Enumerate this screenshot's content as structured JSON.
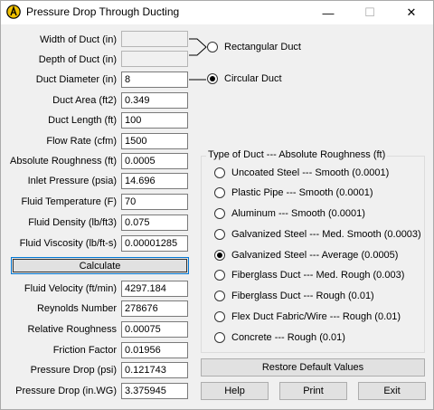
{
  "window": {
    "title": "Pressure Drop Through Ducting",
    "minimize_glyph": "—",
    "maximize_glyph": "☐",
    "close_glyph": "✕"
  },
  "inputs": [
    {
      "label": "Width of Duct (in)",
      "value": "",
      "disabled": true
    },
    {
      "label": "Depth of Duct (in)",
      "value": "",
      "disabled": true
    },
    {
      "label": "Duct Diameter (in)",
      "value": "8"
    },
    {
      "label": "Duct Area (ft2)",
      "value": "0.349"
    },
    {
      "label": "Duct Length (ft)",
      "value": "100"
    },
    {
      "label": "Flow Rate (cfm)",
      "value": "1500"
    },
    {
      "label": "Absolute Roughness (ft)",
      "value": "0.0005"
    },
    {
      "label": "Inlet Pressure (psia)",
      "value": "14.696"
    },
    {
      "label": "Fluid Temperature (F)",
      "value": "70"
    },
    {
      "label": "Fluid Density (lb/ft3)",
      "value": "0.075"
    },
    {
      "label": "Fluid Viscosity (lb/ft-s)",
      "value": "0.00001285"
    }
  ],
  "calculate_label": "Calculate",
  "results": [
    {
      "label": "Fluid Velocity (ft/min)",
      "value": "4297.184"
    },
    {
      "label": "Reynolds Number",
      "value": "278676"
    },
    {
      "label": "Relative Roughness",
      "value": "0.00075"
    },
    {
      "label": "Friction Factor",
      "value": "0.01956"
    },
    {
      "label": "Pressure Drop (psi)",
      "value": "0.121743"
    },
    {
      "label": "Pressure Drop (in.WG)",
      "value": "3.375945"
    }
  ],
  "shape": {
    "rectangular_label": "Rectangular Duct",
    "circular_label": "Circular Duct",
    "selected": "circular"
  },
  "duct_type": {
    "legend": "Type of Duct --- Absolute Roughness (ft)",
    "selected_index": 4,
    "options": [
      "Uncoated Steel --- Smooth  (0.0001)",
      "Plastic Pipe --- Smooth  (0.0001)",
      "Aluminum --- Smooth  (0.0001)",
      "Galvanized Steel --- Med. Smooth  (0.0003)",
      "Galvanized Steel --- Average  (0.0005)",
      "Fiberglass Duct --- Med. Rough  (0.003)",
      "Fiberglass Duct --- Rough  (0.01)",
      "Flex Duct Fabric/Wire --- Rough  (0.01)",
      "Concrete --- Rough  (0.01)"
    ]
  },
  "buttons": {
    "restore": "Restore Default Values",
    "help": "Help",
    "print": "Print",
    "exit": "Exit"
  }
}
